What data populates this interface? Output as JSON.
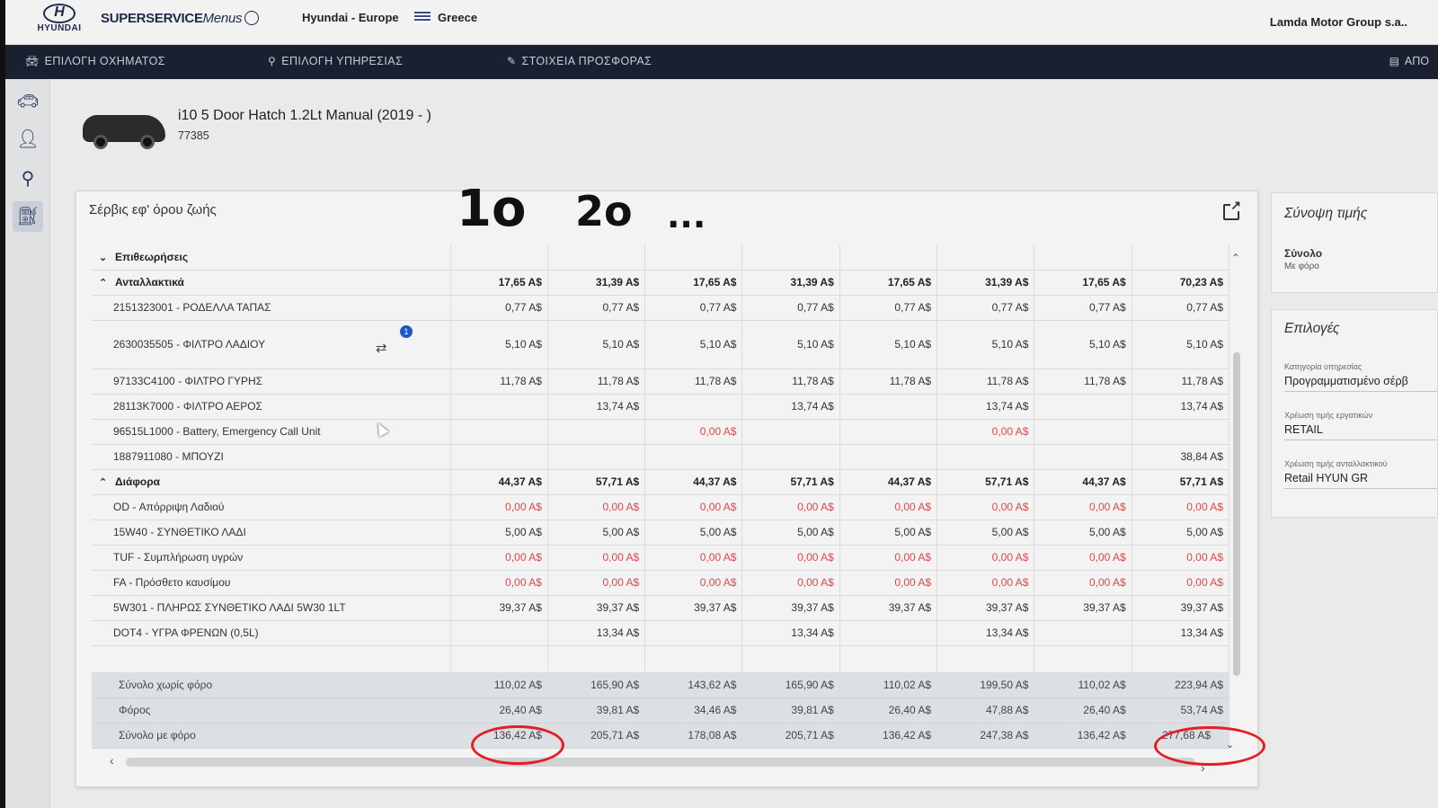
{
  "header": {
    "logo_text": "HYUNDAI",
    "brand": "SUPERSERVICE",
    "brand_menus": "Menus",
    "region": "Hyundai - Europe",
    "country": "Greece",
    "dealer": "Lamda Motor Group s.a.."
  },
  "nav": {
    "items": [
      {
        "label": "ΕΠΙΛΟΓΗ ΟΧΗΜΑΤΟΣ",
        "icon": "car-icon"
      },
      {
        "label": "ΕΠΙΛΟΓΗ ΥΠΗΡΕΣΙΑΣ",
        "icon": "wrench-icon"
      },
      {
        "label": "ΣΤΟΙΧΕΙΑ ΠΡΟΣΦΟΡΑΣ",
        "icon": "pencil-icon"
      }
    ],
    "right": "ΑΠΟ"
  },
  "vehicle": {
    "title": "i10 5 Door Hatch 1.2Lt Manual (2019 - )",
    "code": "77385"
  },
  "card": {
    "title": "Σέρβις εφ' όρου ζωής"
  },
  "handwriting": {
    "first": "1ο",
    "second": "2ο",
    "more": "..."
  },
  "table": {
    "sections": [
      {
        "label": "Επιθεωρήσεις",
        "expanded": false,
        "values": [
          "",
          "",
          "",
          "",
          "",
          "",
          "",
          ""
        ]
      },
      {
        "label": "Ανταλλακτικά",
        "expanded": true,
        "values": [
          "17,65 A$",
          "31,39 A$",
          "17,65 A$",
          "31,39 A$",
          "17,65 A$",
          "31,39 A$",
          "17,65 A$",
          "70,23 A$"
        ],
        "items": [
          {
            "label": "2151323001 - ΡΟΔΕΛΛΑ ΤΑΠΑΣ",
            "values": [
              "0,77 A$",
              "0,77 A$",
              "0,77 A$",
              "0,77 A$",
              "0,77 A$",
              "0,77 A$",
              "0,77 A$",
              "0,77 A$"
            ]
          },
          {
            "label": "2630035505 - ΦΙΛΤΡΟ ΛΑΔΙΟΥ",
            "values": [
              "5,10 A$",
              "5,10 A$",
              "5,10 A$",
              "5,10 A$",
              "5,10 A$",
              "5,10 A$",
              "5,10 A$",
              "5,10 A$"
            ]
          },
          {
            "label": "97133C4100 - ΦΙΛΤΡΟ ΓΥΡΗΣ",
            "values": [
              "11,78 A$",
              "11,78 A$",
              "11,78 A$",
              "11,78 A$",
              "11,78 A$",
              "11,78 A$",
              "11,78 A$",
              "11,78 A$"
            ]
          },
          {
            "label": "28113K7000 - ΦΙΛΤΡΟ ΑΕΡΟΣ",
            "values": [
              "",
              "13,74 A$",
              "",
              "13,74 A$",
              "",
              "13,74 A$",
              "",
              "13,74 A$"
            ]
          },
          {
            "label": "96515L1000 - Battery, Emergency Call Unit",
            "values": [
              "",
              "",
              "0,00 A$",
              "",
              "",
              "0,00 A$",
              "",
              ""
            ]
          },
          {
            "label": "1887911080 - ΜΠΟΥΖΙ",
            "values": [
              "",
              "",
              "",
              "",
              "",
              "",
              "",
              "38,84 A$"
            ]
          }
        ]
      },
      {
        "label": "Διάφορα",
        "expanded": true,
        "values": [
          "44,37 A$",
          "57,71 A$",
          "44,37 A$",
          "57,71 A$",
          "44,37 A$",
          "57,71 A$",
          "44,37 A$",
          "57,71 A$"
        ],
        "items": [
          {
            "label": "OD - Απόρριψη Λαδιού",
            "values": [
              "0,00 A$",
              "0,00 A$",
              "0,00 A$",
              "0,00 A$",
              "0,00 A$",
              "0,00 A$",
              "0,00 A$",
              "0,00 A$"
            ]
          },
          {
            "label": "15W40 - ΣΥΝΘΕΤΙΚΟ ΛΑΔΙ",
            "values": [
              "5,00 A$",
              "5,00 A$",
              "5,00 A$",
              "5,00 A$",
              "5,00 A$",
              "5,00 A$",
              "5,00 A$",
              "5,00 A$"
            ]
          },
          {
            "label": "TUF - Συμπλήρωση υγρών",
            "values": [
              "0,00 A$",
              "0,00 A$",
              "0,00 A$",
              "0,00 A$",
              "0,00 A$",
              "0,00 A$",
              "0,00 A$",
              "0,00 A$"
            ]
          },
          {
            "label": "FA - Πρόσθετο καυσίμου",
            "values": [
              "0,00 A$",
              "0,00 A$",
              "0,00 A$",
              "0,00 A$",
              "0,00 A$",
              "0,00 A$",
              "0,00 A$",
              "0,00 A$"
            ]
          },
          {
            "label": "5W301 - ΠΛΗΡΩΣ ΣΥΝΘΕΤΙΚΟ ΛΑΔΙ 5W30 1LT",
            "values": [
              "39,37 A$",
              "39,37 A$",
              "39,37 A$",
              "39,37 A$",
              "39,37 A$",
              "39,37 A$",
              "39,37 A$",
              "39,37 A$"
            ]
          },
          {
            "label": "DOT4 - ΥΓΡΑ ΦΡΕΝΩΝ (0,5L)",
            "values": [
              "",
              "13,34 A$",
              "",
              "13,34 A$",
              "",
              "13,34 A$",
              "",
              "13,34 A$"
            ]
          }
        ]
      }
    ],
    "totals": [
      {
        "label": "Σύνολο χωρίς φόρο",
        "values": [
          "110,02 A$",
          "165,90 A$",
          "143,62 A$",
          "165,90 A$",
          "110,02 A$",
          "199,50 A$",
          "110,02 A$",
          "223,94 A$"
        ]
      },
      {
        "label": "Φόρος",
        "values": [
          "26,40 A$",
          "39,81 A$",
          "34,46 A$",
          "39,81 A$",
          "26,40 A$",
          "47,88 A$",
          "26,40 A$",
          "53,74 A$"
        ]
      },
      {
        "label": "Σύνολο με φόρο",
        "values": [
          "136,42 A$",
          "205,71 A$",
          "178,08 A$",
          "205,71 A$",
          "136,42 A$",
          "247,38 A$",
          "136,42 A$",
          "277,68 A$"
        ]
      }
    ],
    "part_badge": "1"
  },
  "summary": {
    "title": "Σύνοψη τιμής",
    "total_label": "Σύνολο",
    "total_sub": "Με φόρο"
  },
  "options": {
    "title": "Επιλογές",
    "fields": [
      {
        "label": "Κατηγορία υπηρεσίας",
        "value": "Προγραμματισμένο σέρβ"
      },
      {
        "label": "Χρέωση τιμής εργατικών",
        "value": "RETAIL"
      },
      {
        "label": "Χρέωση τιμής ανταλλακτικού",
        "value": "Retail HYUN GR"
      }
    ]
  },
  "colors": {
    "nav_bg": "#1a2030",
    "zero_value_red": "#e0474a",
    "annotation_red": "#e41e26",
    "brand_blue": "#1c2a4a"
  }
}
